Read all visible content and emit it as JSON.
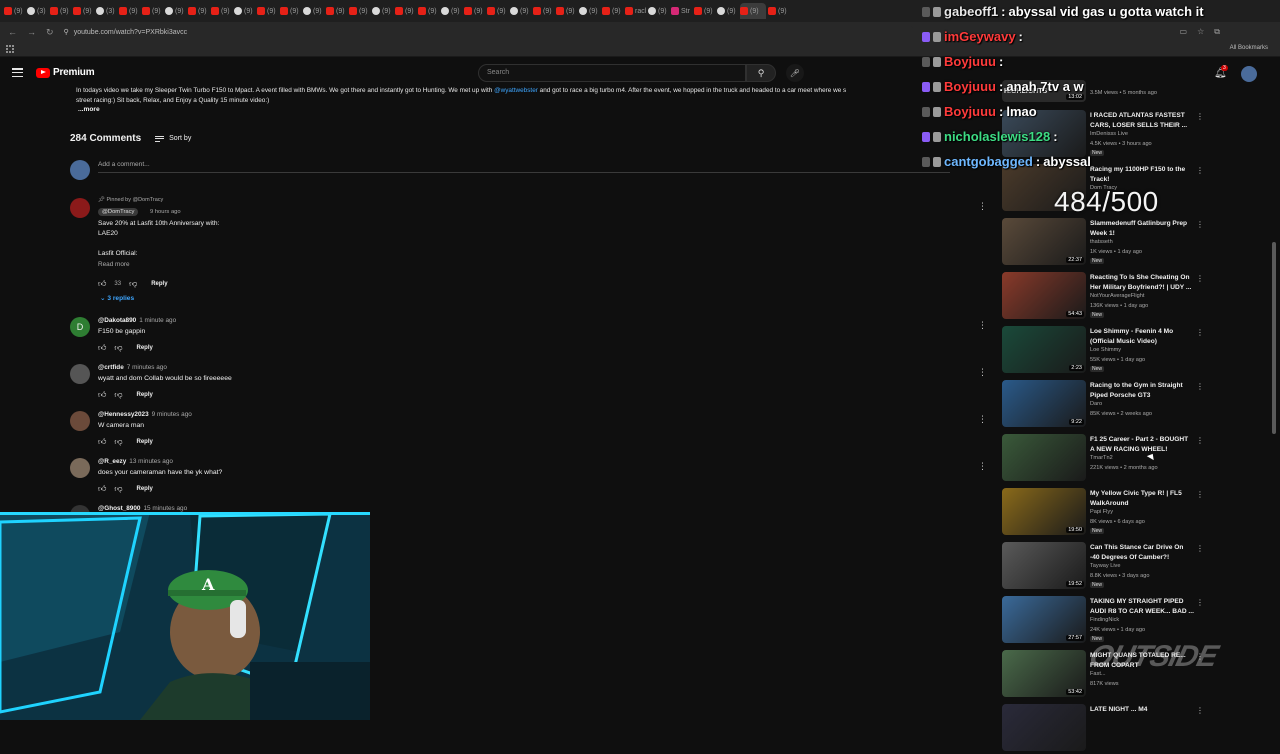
{
  "browser": {
    "tab_labels": [
      "(9)",
      "(3)",
      "(9)",
      "(9)",
      "(3)",
      "(9)",
      "(9)",
      "(9)",
      "(9)",
      "(9)",
      "(9)",
      "(9)",
      "(9)",
      "(9)",
      "(9)",
      "(9)",
      "(9)",
      "(9)",
      "(9)",
      "(9)",
      "(9)",
      "(9)",
      "(9)",
      "(9)",
      "(9)",
      "(9)",
      "(9)",
      "racl",
      "(9)",
      "Str",
      "(9)",
      "(9)",
      "(9)",
      "(9)"
    ],
    "url": "youtube.com/watch?v=PXRbki3avcc",
    "all_bookmarks": "All Bookmarks"
  },
  "header": {
    "logo_text": "Premium",
    "search_placeholder": "Search",
    "notification_count": "3"
  },
  "description": {
    "text_a": "In todays video we take my Sleeper Twin Turbo F150 to Mpact. A event filled with BMWs. We got there and instantly got to Hunting. We met up with",
    "mention": "@wyattwebster",
    "text_b": "and got to race a big turbo m4.  After the event, we hopped in the truck and headed to a car meet where we s",
    "text_c": "street racing:) Sit back, Relax, and Enjoy a Quality 15 minute video:)",
    "more_label": "...more"
  },
  "comments": {
    "count_label": "284 Comments",
    "sort_label": "Sort by",
    "add_placeholder": "Add a comment...",
    "pinned": {
      "pinned_by": "Pinned by @DomTracy",
      "author": "@DomTracy",
      "time": "9 hours ago",
      "line1": "Save 20% at Lasfit 10th Anniversary with:",
      "line2": "LAE20",
      "line3": "Lasfit Official:",
      "read_more": "Read more",
      "likes": "33",
      "reply_label": "Reply",
      "replies_label": "3 replies"
    },
    "items": [
      {
        "author": "@Dakota890",
        "time": "1 minute ago",
        "text": "F150 be gappin",
        "avatar_letter": "D",
        "avatar_color": "#2e7d32",
        "reply_label": "Reply"
      },
      {
        "author": "@crtfide",
        "time": "7 minutes ago",
        "text": "wyatt and dom Collab would be so fireeeeee",
        "avatar_letter": "",
        "avatar_color": "#555555",
        "reply_label": "Reply"
      },
      {
        "author": "@Hennessy2023",
        "time": "9 minutes ago",
        "text": "W camera man",
        "avatar_letter": "",
        "avatar_color": "#6b4a3a",
        "reply_label": "Reply"
      },
      {
        "author": "@R_eezy",
        "time": "13 minutes ago",
        "text": "does your cameraman have the yk what?",
        "avatar_letter": "",
        "avatar_color": "#7a6a5a",
        "reply_label": "Reply"
      },
      {
        "author": "@Ghost_8900",
        "time": "15 minutes ago",
        "text": "",
        "avatar_letter": "",
        "avatar_color": "#333333",
        "reply_label": ""
      }
    ]
  },
  "sidebar": {
    "partial_top": {
      "title": "HIGHLIGHTS",
      "duration": "13:02",
      "meta": "3.5M views • 5 months ago"
    },
    "videos": [
      {
        "title": "I RACED ATLANTAS FASTEST CARS, LOSER SELLS THEIR ...",
        "channel": "ImDenisss Live",
        "meta": "4.5K views • 3 hours ago",
        "new": "New",
        "duration": "",
        "thumb_color": "#3a4a5a"
      },
      {
        "title": "Racing my 1100HP F150 to the Track!",
        "channel": "Dom Tracy",
        "meta": "",
        "new": "",
        "duration": "",
        "thumb_color": "#4a3a2a"
      },
      {
        "title": "Slammedenuff Gatlinburg Prep Week 1!",
        "channel": "thatsseth",
        "meta": "1K views • 1 day ago",
        "new": "New",
        "duration": "22:37",
        "thumb_color": "#5a4a3a"
      },
      {
        "title": "Reacting To Is She Cheating On Her Military Boyfriend?! | UDY ...",
        "channel": "NotYourAverageFlight",
        "meta": "136K views • 1 day ago",
        "new": "New",
        "duration": "54:43",
        "thumb_color": "#8a3a2a"
      },
      {
        "title": "Loe Shimmy - Feenin 4 Mo (Official Music Video)",
        "channel": "Loe Shimmy",
        "meta": "55K views • 1 day ago",
        "new": "New",
        "duration": "2:23",
        "thumb_color": "#1a4a3a"
      },
      {
        "title": "Racing to the Gym in Straight Piped Porsche GT3",
        "channel": "Daro",
        "meta": "85K views • 2 weeks ago",
        "new": "",
        "duration": "9:22",
        "thumb_color": "#2a5a8a"
      },
      {
        "title": "F1 25 Career - Part 2 - BOUGHT A NEW RACING WHEEL!",
        "channel": "TmarTn2",
        "meta": "221K views • 2 months ago",
        "new": "",
        "duration": "",
        "thumb_color": "#3a5a3a"
      },
      {
        "title": "My Yellow Civic Type R! | FL5 WalkAround",
        "channel": "Papi Flyy",
        "meta": "8K views • 6 days ago",
        "new": "New",
        "duration": "19:50",
        "thumb_color": "#8a6a1a"
      },
      {
        "title": "Can This Stance Car Drive On -40 Degrees Of Camber?!",
        "channel": "Tayway Live",
        "meta": "8.8K views • 3 days ago",
        "new": "New",
        "duration": "19:52",
        "thumb_color": "#5a5a5a"
      },
      {
        "title": "TAKING MY STRAIGHT PIPED AUDI R8 TO CAR WEEK... BAD ...",
        "channel": "FindingNick",
        "meta": "24K views • 1 day ago",
        "new": "New",
        "duration": "27:57",
        "thumb_color": "#3a6a9a"
      },
      {
        "title": "MIGHT QUANS TOTALED RE... FROM COPART",
        "channel": "Fast...",
        "meta": "817K views",
        "new": "",
        "duration": "53:42",
        "thumb_color": "#4a6a4a"
      },
      {
        "title": "LATE NIGHT ... M4",
        "channel": "",
        "meta": "",
        "new": "",
        "duration": "",
        "thumb_color": "#2a2a3a"
      }
    ]
  },
  "overlay": {
    "chat": [
      {
        "user": "gabeoff1",
        "msg": "abyssal vid gas u gotta watch it",
        "color": "#e8e8e8"
      },
      {
        "user": "imGeywavy",
        "msg": "",
        "color": "#ff3b3b"
      },
      {
        "user": "Boyjuuu",
        "msg": "",
        "color": "#ff3b3b"
      },
      {
        "user": "Boyjuuu",
        "msg": "anah 7tv a w",
        "color": "#ff3b3b"
      },
      {
        "user": "Boyjuuu",
        "msg": "lmao",
        "color": "#ff3b3b"
      },
      {
        "user": "nicholaslewis128",
        "msg": "",
        "color": "#3ddc84"
      },
      {
        "user": "cantgobagged",
        "msg": "abyssal",
        "color": "#6fb8ff"
      }
    ],
    "counter": "484/500",
    "watermark": "OUTSIDE"
  }
}
